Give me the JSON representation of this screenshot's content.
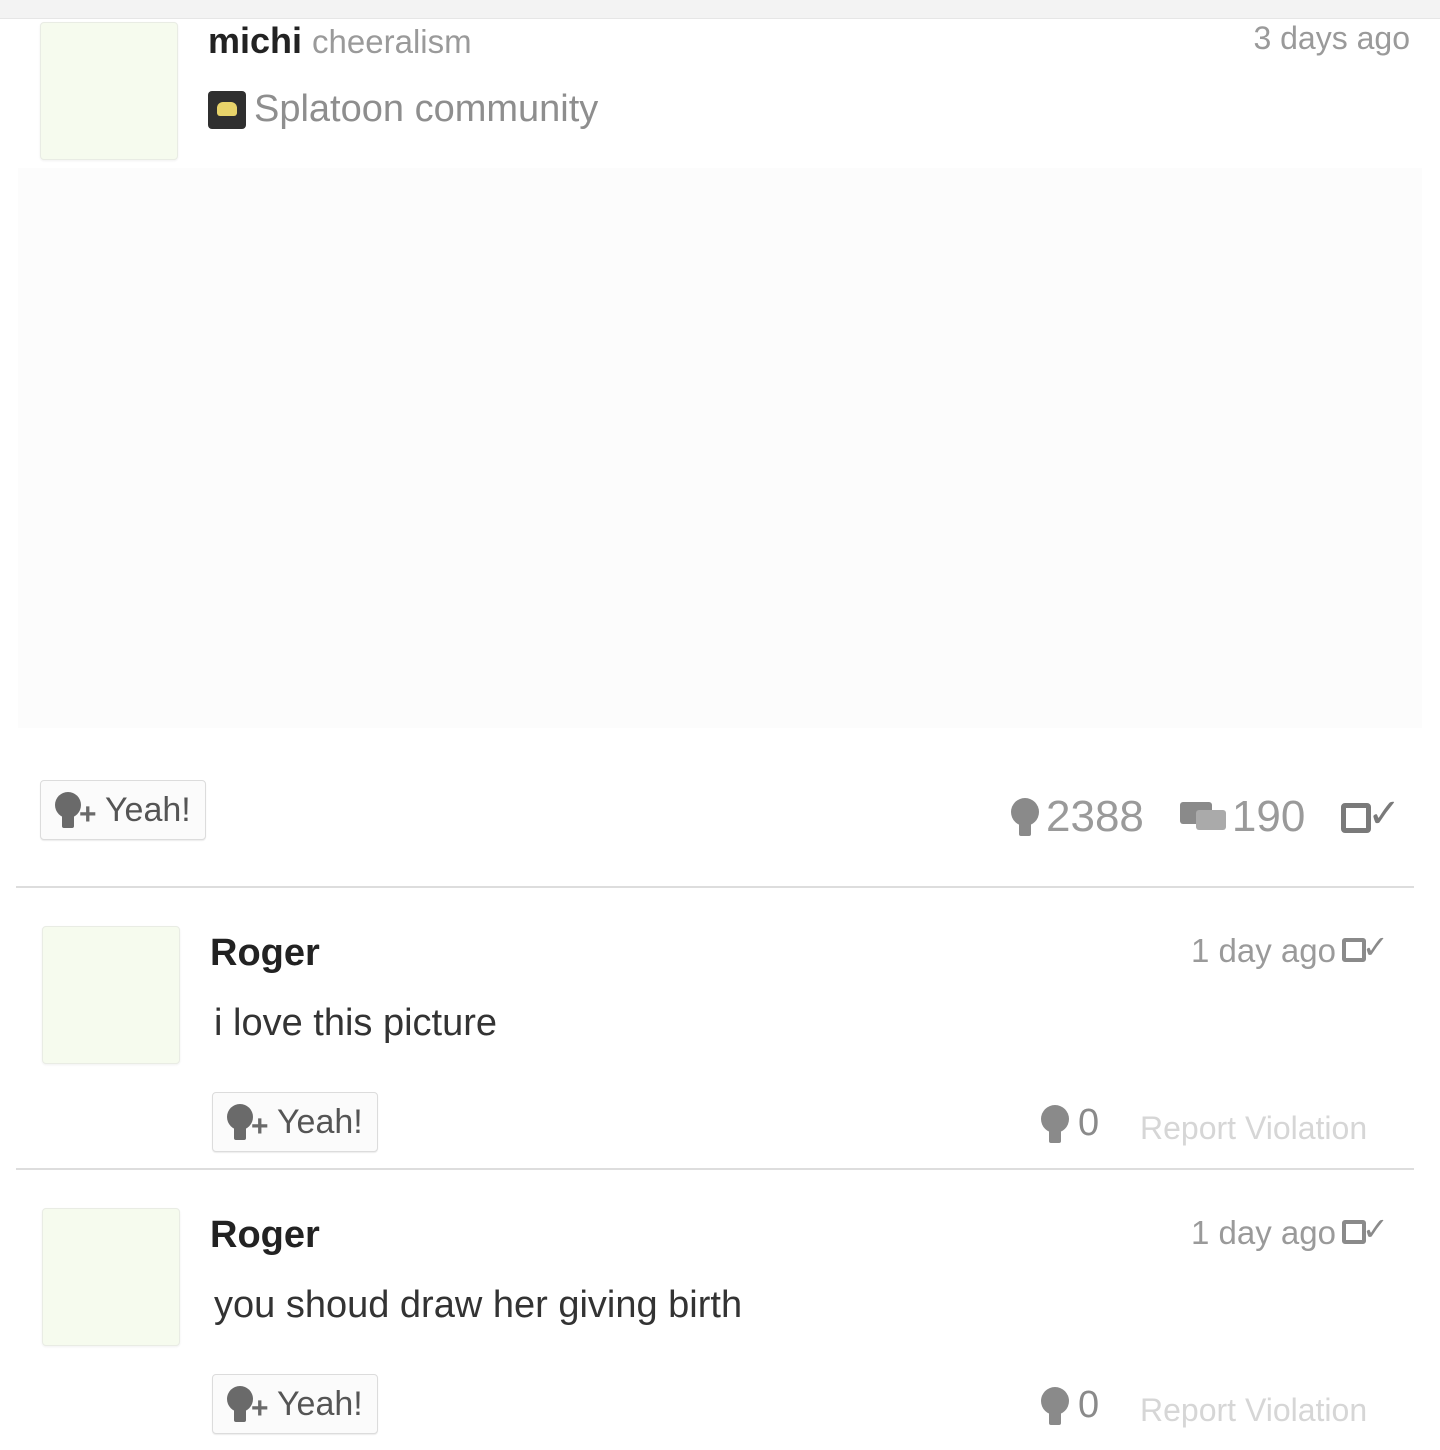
{
  "post": {
    "username": "michi",
    "handle": "cheeralism",
    "timestamp": "3 days ago",
    "community": "Splatoon community",
    "yeah_label": "Yeah!",
    "yeah_count": "2388",
    "comment_count": "190"
  },
  "comments": [
    {
      "username": "Roger",
      "timestamp": "1 day ago",
      "body": "i love this picture",
      "yeah_label": "Yeah!",
      "yeah_count": "0",
      "report_label": "Report Violation"
    },
    {
      "username": "Roger",
      "timestamp": "1 day ago",
      "body": "you shoud draw her giving birth",
      "yeah_label": "Yeah!",
      "yeah_count": "0",
      "report_label": "Report Violation"
    }
  ],
  "icons": {
    "community": "splatoon-community-icon",
    "yeah": "yeah-add-icon",
    "yeah_count": "yeah-count-icon",
    "comments": "comments-icon",
    "share": "share-icon"
  }
}
